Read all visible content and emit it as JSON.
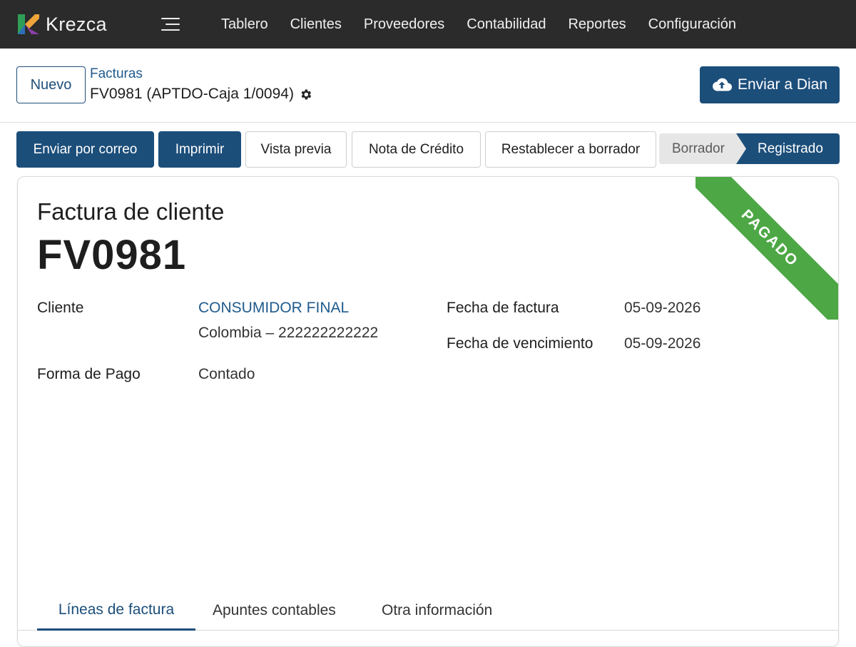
{
  "navbar": {
    "brand": "Krezca",
    "menu": [
      "Tablero",
      "Clientes",
      "Proveedores",
      "Contabilidad",
      "Reportes",
      "Configuración"
    ]
  },
  "control": {
    "new_label": "Nuevo",
    "breadcrumb_parent": "Facturas",
    "breadcrumb_current": "FV0981 (APTDO-Caja 1/0094)",
    "send_dian_label": "Enviar a Dian"
  },
  "actions": {
    "email": "Enviar por correo",
    "print": "Imprimir",
    "preview": "Vista previa",
    "credit_note": "Nota de Crédito",
    "reset_draft": "Restablecer a borrador"
  },
  "status": {
    "stages": [
      "Borrador",
      "Registrado"
    ],
    "current": "Registrado"
  },
  "invoice": {
    "type_label": "Factura de cliente",
    "number": "FV0981",
    "ribbon": "PAGADO",
    "customer_label": "Cliente",
    "customer_name": "CONSUMIDOR FINAL",
    "customer_address": "Colombia – 222222222222",
    "payment_label": "Forma de Pago",
    "payment_value": "Contado",
    "date_label": "Fecha de factura",
    "date_value": "05-09-2026",
    "due_label": "Fecha de vencimiento",
    "due_value": "05-09-2026"
  },
  "tabs": [
    "Líneas de factura",
    "Apuntes contables",
    "Otra información"
  ],
  "colors": {
    "navbar_bg": "#2b2b2b",
    "primary": "#1c4e7a",
    "link": "#1f5a8c",
    "paid_ribbon": "#4ca744"
  }
}
